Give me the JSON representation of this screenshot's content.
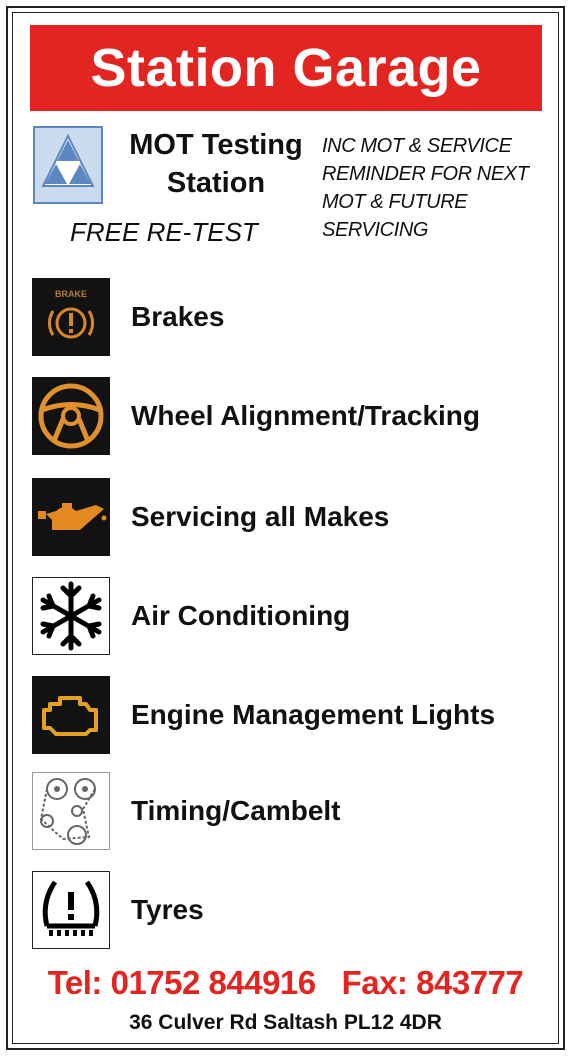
{
  "banner": {
    "title": "Station Garage",
    "bg_color": "#e32522"
  },
  "mot": {
    "logo_icon": "mot-triangles-icon",
    "title_line1": "MOT Testing",
    "title_line2": "Station",
    "free_retest": "FREE RE-TEST",
    "reminder_lines": [
      "INC MOT & SERVICE",
      "REMINDER FOR NEXT",
      "MOT & FUTURE",
      "SERVICING"
    ]
  },
  "services": [
    {
      "label": "Brakes",
      "icon": "brake-warning-icon",
      "icon_text": "BRAKE"
    },
    {
      "label": "Wheel Alignment/Tracking",
      "icon": "steering-wheel-icon"
    },
    {
      "label": "Servicing all Makes",
      "icon": "oil-can-icon"
    },
    {
      "label": "Air Conditioning",
      "icon": "snowflake-icon"
    },
    {
      "label": "Engine Management Lights",
      "icon": "engine-light-icon"
    },
    {
      "label": "Timing/Cambelt",
      "icon": "cambelt-icon"
    },
    {
      "label": "Tyres",
      "icon": "tyre-pressure-icon"
    }
  ],
  "contact": {
    "tel": "Tel: 01752 844916   Fax: 843777",
    "address": "36 Culver Rd Saltash PL12 4DR",
    "accent_color": "#e32522"
  }
}
